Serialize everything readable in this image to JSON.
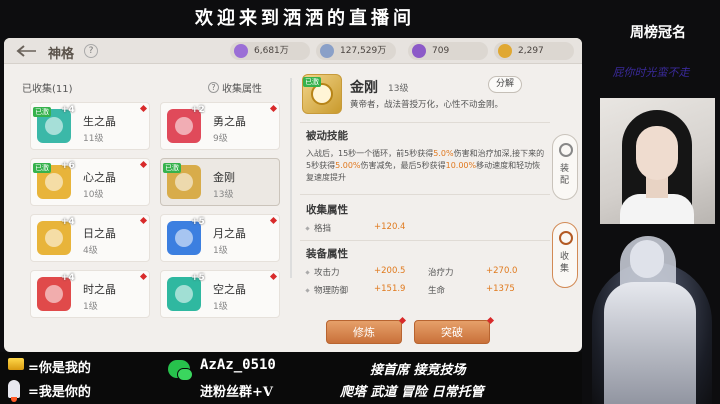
{
  "overlay": {
    "stream_title": "欢迎来到洒洒的直播间",
    "rank_title": "周榜冠名",
    "rank_name": "屁你时光蛮不走",
    "legend_1": "=你是我的",
    "legend_2": "=我是你的",
    "wechat_id": "AzAz_0510",
    "wechat_note": "进粉丝群+V",
    "services_1": "接首席 接竞技场",
    "services_2": "爬塔 武道 冒险 日常托管"
  },
  "header": {
    "title": "神格",
    "help": "?",
    "resources": [
      {
        "value": "6,681万",
        "icon": "purple-crystal-icon",
        "color": "#9b6fd6"
      },
      {
        "value": "127,529万",
        "icon": "silver-crystal-icon",
        "color": "#8aa0c8"
      },
      {
        "value": "709",
        "icon": "purple-gem-icon",
        "color": "#8c5ac8"
      },
      {
        "value": "2,297",
        "icon": "gold-coin-icon",
        "color": "#e0a832"
      }
    ]
  },
  "collection": {
    "collected_label": "已收集(11)",
    "attr_label": "收集属性",
    "owned_tag": "已激",
    "items": [
      {
        "name": "生之晶",
        "level": "11级",
        "plus": "+4",
        "color": "#3bb8a8",
        "icon": "life-crystal-icon"
      },
      {
        "name": "勇之晶",
        "level": "9级",
        "plus": "+2",
        "color": "#e04a5a",
        "icon": "courage-crystal-icon"
      },
      {
        "name": "心之晶",
        "level": "10级",
        "plus": "+6",
        "color": "#e8b43a",
        "icon": "heart-crystal-icon"
      },
      {
        "name": "金刚",
        "level": "13级",
        "plus": "",
        "color": "#d8ac4a",
        "icon": "vajra-icon"
      },
      {
        "name": "日之晶",
        "level": "4级",
        "plus": "+4",
        "color": "#e8b43a",
        "icon": "sun-crystal-icon"
      },
      {
        "name": "月之晶",
        "level": "1级",
        "plus": "+5",
        "color": "#3c7fe0",
        "icon": "moon-crystal-icon"
      },
      {
        "name": "时之晶",
        "level": "1级",
        "plus": "+4",
        "color": "#e04a4a",
        "icon": "time-crystal-icon"
      },
      {
        "name": "空之晶",
        "level": "1级",
        "plus": "+5",
        "color": "#2fb8a0",
        "icon": "void-crystal-icon"
      }
    ]
  },
  "detail": {
    "owned_tag": "已激",
    "name": "金刚",
    "level": "13级",
    "desc": "黄帝者，战法普授万化，心性不动金刚。",
    "decompose": "分解",
    "passive_title": "被动技能",
    "passive_pre1": "入战后，15秒一个循环，前5秒获得",
    "passive_hl1": "5.0%",
    "passive_mid1": "伤害和治疗加深,",
    "passive_pre2": "接下来的5秒获得",
    "passive_hl2": "5.00%",
    "passive_mid2": "伤害减免，最后5秒获得",
    "passive_hl3": "10.00%",
    "passive_post": "移动速度和轻功恢复速度提升",
    "collect_title": "收集属性",
    "collect_rows": [
      {
        "k": "格挡",
        "v": "+120.4"
      }
    ],
    "equip_title": "装备属性",
    "equip_rows": [
      {
        "k": "攻击力",
        "v": "+200.5",
        "k2": "治疗力",
        "v2": "+270.0"
      },
      {
        "k": "物理防御",
        "v": "+151.9",
        "k2": "生命",
        "v2": "+1375"
      }
    ],
    "btn_train": "修炼",
    "btn_break": "突破"
  },
  "sidetabs": {
    "equip": "装配",
    "collect": "收集"
  }
}
